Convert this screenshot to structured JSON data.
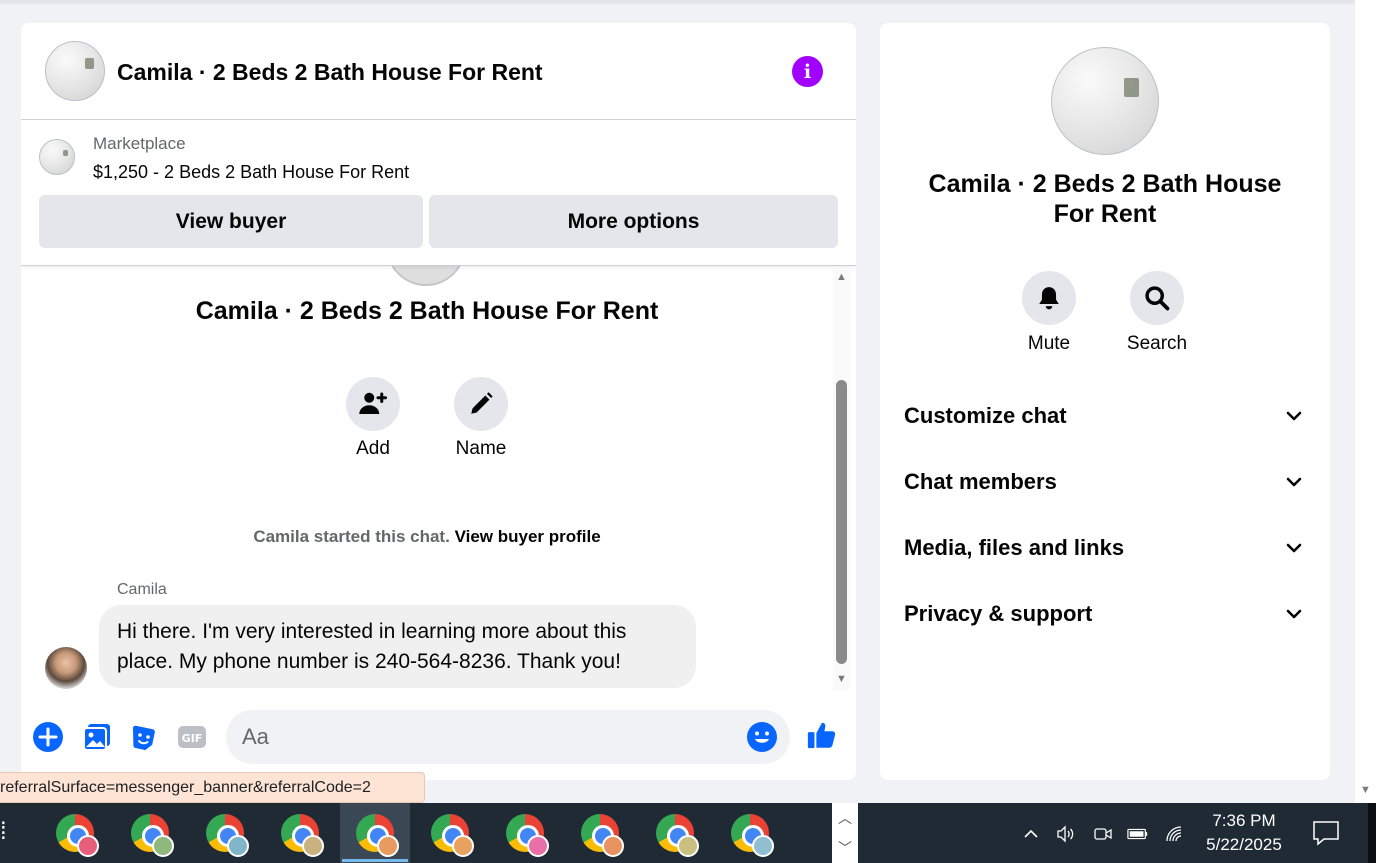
{
  "chat": {
    "title": "Camila · 2 Beds 2 Bath House For Rent",
    "info_icon": "info-icon",
    "marketplace": {
      "label": "Marketplace",
      "listing": "$1,250 - 2 Beds 2 Bath House For Rent",
      "view_buyer": "View buyer",
      "more_options": "More options"
    },
    "conversation_title": "Camila · 2 Beds 2 Bath House For Rent",
    "actions": [
      {
        "label": "Add",
        "icon": "add-person-icon"
      },
      {
        "label": "Name",
        "icon": "pencil-icon"
      }
    ],
    "started_text": "Camila started this chat.",
    "view_buyer_profile": "View buyer profile",
    "message": {
      "sender": "Camila",
      "text": "Hi there. I'm very interested in learning more about this place. My phone number is 240-564-8236. Thank you!"
    },
    "composer": {
      "placeholder": "Aa",
      "icons": [
        "plus-circle-icon",
        "photo-icon",
        "sticker-icon",
        "gif-icon",
        "emoji-icon",
        "thumbs-up-icon"
      ],
      "gif_label": "GIF"
    }
  },
  "status_url": "referralSurface=messenger_banner&referralCode=2",
  "info_panel": {
    "title": "Camila · 2 Beds 2 Bath House For Rent",
    "actions": [
      {
        "label": "Mute",
        "icon": "bell-icon"
      },
      {
        "label": "Search",
        "icon": "search-icon"
      }
    ],
    "sections": [
      "Customize chat",
      "Chat members",
      "Media, files and links",
      "Privacy & support"
    ]
  },
  "taskbar": {
    "apps_count": 10,
    "clock_time": "7:36 PM",
    "clock_date": "5/22/2025"
  },
  "colors": {
    "accent_purple": "#a200ff",
    "messenger_blue": "#0866ff",
    "taskbar_bg": "#1f2a35"
  }
}
